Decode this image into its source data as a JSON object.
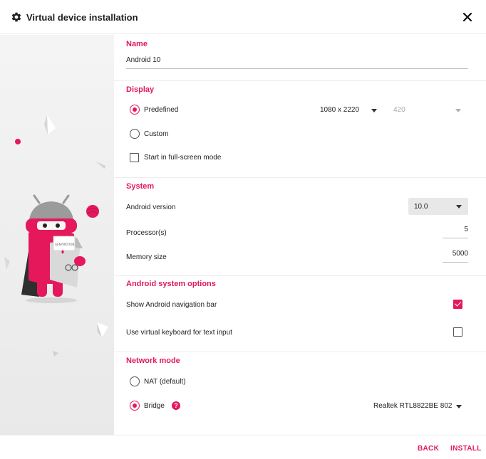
{
  "dialog": {
    "title": "Virtual device installation",
    "title_icon": "gear-icon",
    "close_icon": "close-icon"
  },
  "name_section": {
    "title": "Name",
    "value": "Android 10"
  },
  "display_section": {
    "title": "Display",
    "predefined_label": "Predefined",
    "predefined_checked": true,
    "resolution_value": "1080 x 2220",
    "dpi_value": "420",
    "custom_label": "Custom",
    "custom_checked": false,
    "fullscreen_label": "Start in full-screen mode",
    "fullscreen_checked": false
  },
  "system_section": {
    "title": "System",
    "android_version_label": "Android version",
    "android_version_value": "10.0",
    "processors_label": "Processor(s)",
    "processors_value": "5",
    "memory_label": "Memory size",
    "memory_value": "5000"
  },
  "android_options_section": {
    "title": "Android system options",
    "nav_bar_label": "Show Android navigation bar",
    "nav_bar_checked": true,
    "virtual_keyboard_label": "Use virtual keyboard for text input",
    "virtual_keyboard_checked": false
  },
  "network_section": {
    "title": "Network mode",
    "nat_label": "NAT (default)",
    "nat_checked": false,
    "bridge_label": "Bridge",
    "bridge_checked": true,
    "help_symbol": "?",
    "bridge_adapter_value": "Realtek RTL8822BE 802"
  },
  "footer": {
    "back_label": "BACK",
    "install_label": "INSTALL"
  },
  "illustration": {
    "subject": "robot-mascot-illustration",
    "box_text": "GENYMOTION"
  },
  "colors": {
    "accent": "#e4185b",
    "panel_bg": "#f1f1f1",
    "divider": "#ededed"
  }
}
